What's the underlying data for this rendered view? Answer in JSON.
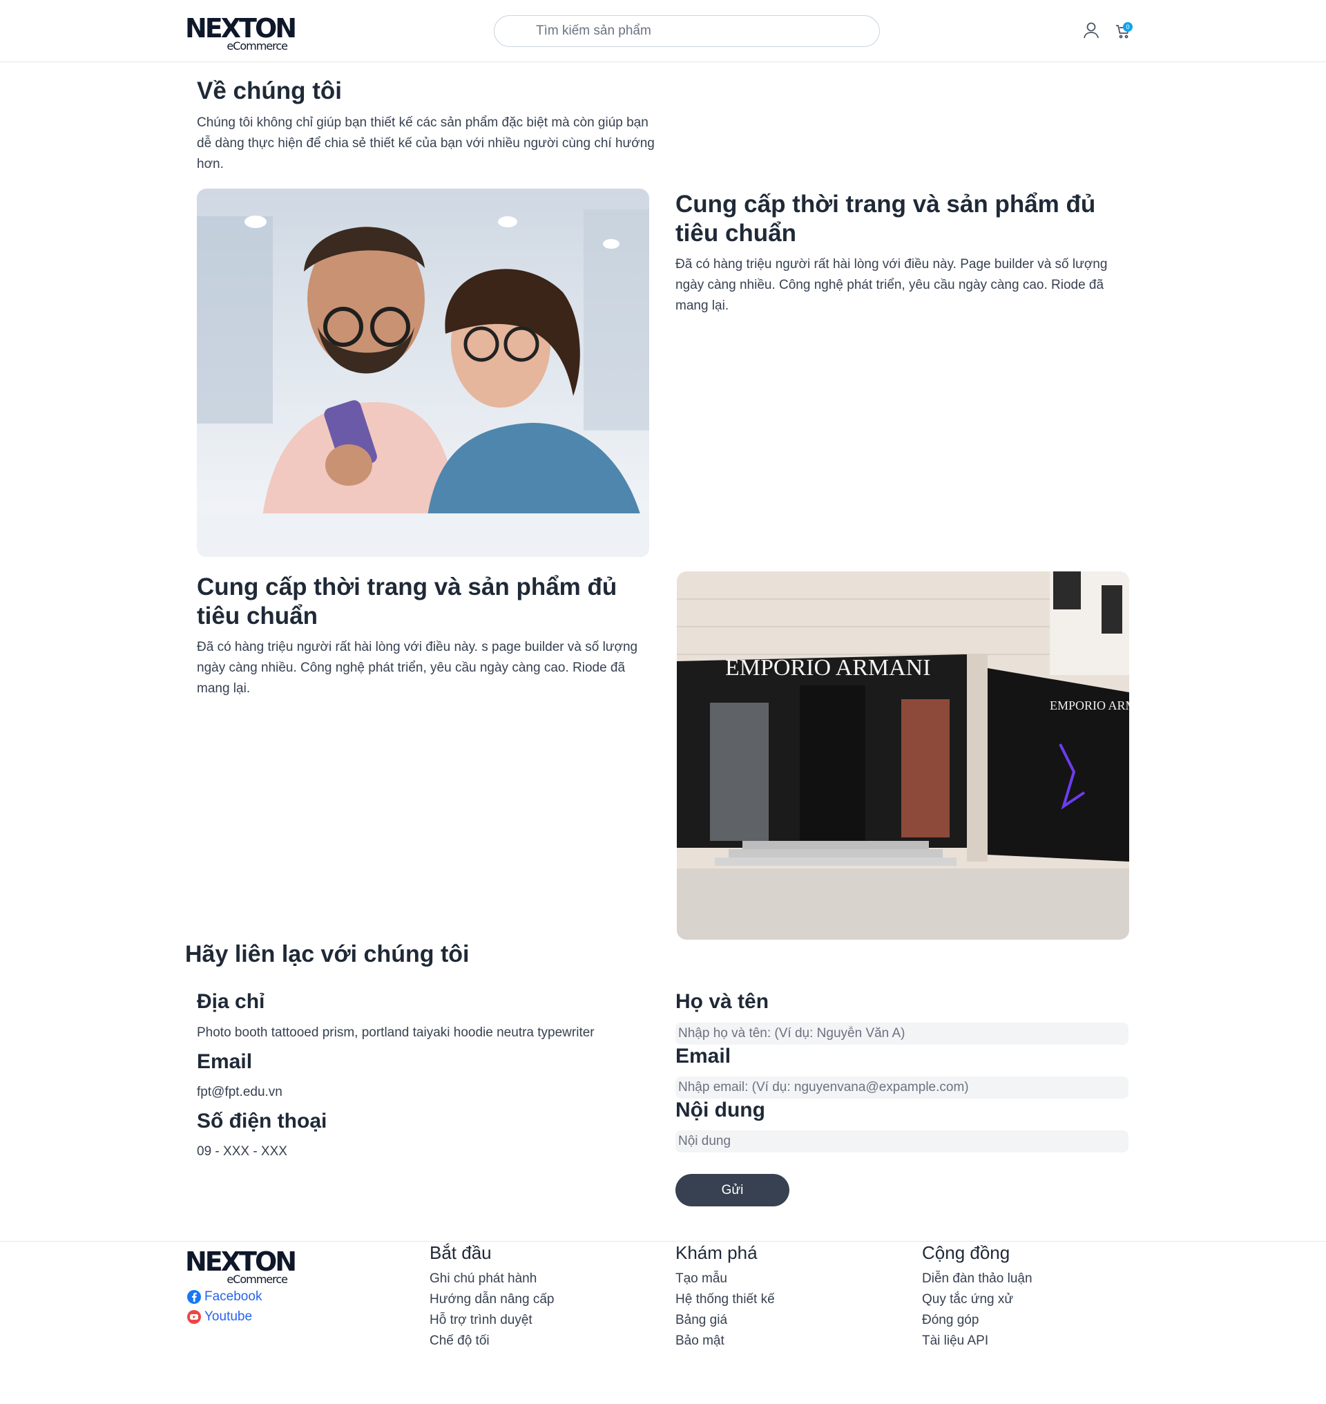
{
  "header": {
    "logo_brand": "NEXTON",
    "logo_sub": "eCommerce",
    "search_placeholder": "Tìm kiếm sản phẩm",
    "cart_count": "0"
  },
  "about": {
    "title": "Về chúng tôi",
    "intro": "Chúng tôi không chỉ giúp bạn thiết kế các sản phẩm đặc biệt mà còn giúp bạn dễ dàng thực hiện để chia sẻ thiết kế của bạn với nhiều người cùng chí hướng hơn.",
    "block1": {
      "title": "Cung cấp thời trang và sản phẩm đủ tiêu chuẩn",
      "text": "Đã có hàng triệu người rất hài lòng với điều này. Page builder và số lượng ngày càng nhiều. Công nghệ phát triển, yêu cầu ngày càng cao. Riode đã mang lại."
    },
    "block2": {
      "title": "Cung cấp thời trang và sản phẩm đủ tiêu chuẩn",
      "text": "Đã có hàng triệu người rất hài lòng với điều này. s page builder và số lượng ngày càng nhiều. Công nghệ phát triển, yêu cầu ngày càng cao. Riode đã mang lại."
    },
    "store_sign_1": "EMPORIO ARMANI",
    "store_sign_2": "EMPORIO ARMANI"
  },
  "contact": {
    "title": "Hãy liên lạc với chúng tôi",
    "address_label": "Địa chỉ",
    "address_value": "Photo booth tattooed prism, portland taiyaki hoodie neutra typewriter",
    "email_label": "Email",
    "email_value": "fpt@fpt.edu.vn",
    "phone_label": "Số điện thoại",
    "phone_value": "09 - XXX - XXX",
    "form": {
      "name_label": "Họ và tên",
      "name_placeholder": "Nhập họ và tên: (Ví dụ: Nguyễn Văn A)",
      "email_label": "Email",
      "email_placeholder": "Nhập email: (Ví dụ: nguyenvana@expample.com)",
      "content_label": "Nội dung",
      "content_placeholder": "Nội dung",
      "submit_label": "Gửi"
    }
  },
  "footer": {
    "logo_brand": "NEXTON",
    "logo_sub": "eCommerce",
    "facebook": "Facebook",
    "youtube": "Youtube",
    "columns": [
      {
        "title": "Bắt đầu",
        "links": [
          "Ghi chú phát hành",
          "Hướng dẫn nâng cấp",
          "Hỗ trợ trình duyệt",
          "Chế độ tối"
        ]
      },
      {
        "title": "Khám phá",
        "links": [
          "Tạo mẫu",
          "Hệ thống thiết kế",
          "Bảng giá",
          "Bảo mật"
        ]
      },
      {
        "title": "Cộng đồng",
        "links": [
          "Diễn đàn thảo luận",
          "Quy tắc ứng xử",
          "Đóng góp",
          "Tài liệu API"
        ]
      }
    ]
  },
  "colors": {
    "button_bg": "#374151",
    "link_blue": "#2563eb",
    "badge": "#0ea5e9"
  }
}
